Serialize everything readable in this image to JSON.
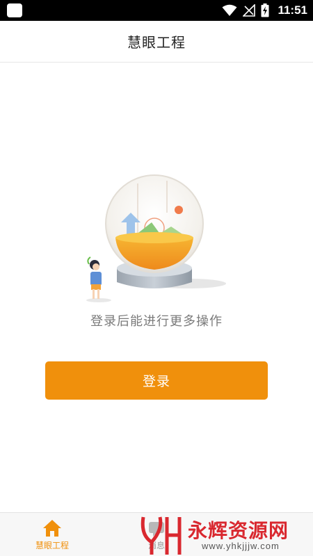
{
  "status_bar": {
    "time": "11:51",
    "icons": [
      "app-square-icon",
      "wifi-icon",
      "no-signal-icon",
      "battery-charging-icon"
    ]
  },
  "title_bar": {
    "title": "慧眼工程"
  },
  "main": {
    "illustration": "crystal-ball-with-person-illustration",
    "prompt": "登录后能进行更多操作",
    "login_button": "登录"
  },
  "bottom_nav": {
    "items": [
      {
        "label": "慧眼工程",
        "icon": "home-icon",
        "active": true
      },
      {
        "label": "消息",
        "icon": "message-icon",
        "active": false
      }
    ]
  },
  "watermark": {
    "text": "永辉资源网",
    "url": "www.yhkjjjw.com",
    "logo": "yh-logo"
  },
  "colors": {
    "accent": "#f0900c",
    "title_text": "#222222",
    "prompt_text": "#7a7a7a",
    "watermark_red": "#d9282f"
  }
}
